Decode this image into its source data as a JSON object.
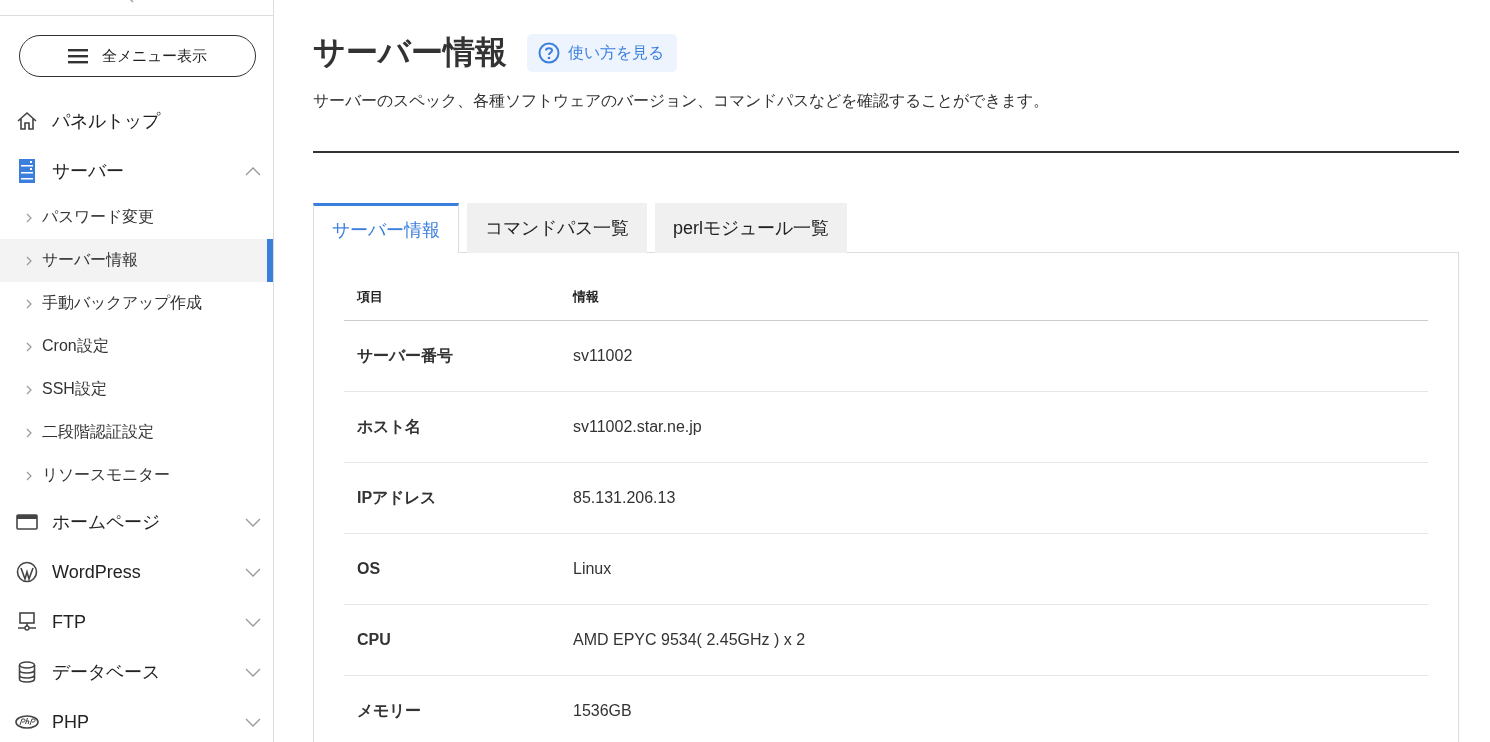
{
  "sidebar": {
    "menu_button": "全メニュー表示",
    "items": [
      {
        "label": "パネルトップ"
      },
      {
        "label": "サーバー",
        "expanded": true,
        "children": [
          {
            "label": "パスワード変更",
            "selected": false
          },
          {
            "label": "サーバー情報",
            "selected": true
          },
          {
            "label": "手動バックアップ作成",
            "selected": false
          },
          {
            "label": "Cron設定",
            "selected": false
          },
          {
            "label": "SSH設定",
            "selected": false
          },
          {
            "label": "二段階認証設定",
            "selected": false
          },
          {
            "label": "リソースモニター",
            "selected": false
          }
        ]
      },
      {
        "label": "ホームページ",
        "expanded": false
      },
      {
        "label": "WordPress",
        "expanded": false
      },
      {
        "label": "FTP",
        "expanded": false
      },
      {
        "label": "データベース",
        "expanded": false
      },
      {
        "label": "PHP",
        "expanded": false
      }
    ]
  },
  "page": {
    "title": "サーバー情報",
    "help_link": "使い方を見る",
    "description": "サーバーのスペック、各種ソフトウェアのバージョン、コマンドパスなどを確認することができます。"
  },
  "tabs": [
    {
      "label": "サーバー情報",
      "selected": true
    },
    {
      "label": "コマンドパス一覧",
      "selected": false
    },
    {
      "label": "perlモジュール一覧",
      "selected": false
    }
  ],
  "table": {
    "columns": [
      "項目",
      "情報"
    ],
    "rows": [
      [
        "サーバー番号",
        "sv11002"
      ],
      [
        "ホスト名",
        "sv11002.star.ne.jp"
      ],
      [
        "IPアドレス",
        "85.131.206.13"
      ],
      [
        "OS",
        "Linux"
      ],
      [
        "CPU",
        "AMD EPYC 9534( 2.45GHz ) x 2"
      ],
      [
        "メモリー",
        "1536GB"
      ]
    ]
  }
}
